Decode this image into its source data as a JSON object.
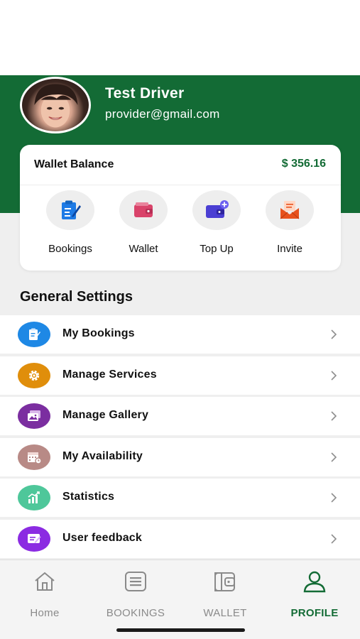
{
  "profile": {
    "name": "Test Driver",
    "email": "provider@gmail.com"
  },
  "wallet": {
    "label": "Wallet Balance",
    "amount": "$ 356.16",
    "actions": [
      {
        "label": "Bookings",
        "icon": "bookings-clipboard-icon",
        "color": "#1e7be6"
      },
      {
        "label": "Wallet",
        "icon": "wallet-icon",
        "color": "#d9436a"
      },
      {
        "label": "Top Up",
        "icon": "top-up-icon",
        "color": "#4b3fd3"
      },
      {
        "label": "Invite",
        "icon": "invite-envelope-icon",
        "color": "#e8521d"
      }
    ]
  },
  "general_settings": {
    "title": "General Settings",
    "items": [
      {
        "label": "My Bookings",
        "icon": "clipboard-icon",
        "color": "#1e88e5"
      },
      {
        "label": "Manage Services",
        "icon": "gear-icon",
        "color": "#e08e0b"
      },
      {
        "label": "Manage Gallery",
        "icon": "gallery-icon",
        "color": "#7b2ea0"
      },
      {
        "label": "My Availability",
        "icon": "calendar-icon",
        "color": "#b88a86"
      },
      {
        "label": "Statistics",
        "icon": "chart-icon",
        "color": "#4ec79a"
      },
      {
        "label": "User feedback",
        "icon": "feedback-icon",
        "color": "#8b2be2"
      }
    ]
  },
  "bottom_nav": {
    "items": [
      {
        "label": "Home",
        "icon": "home-icon",
        "active": false
      },
      {
        "label": "BOOKINGS",
        "icon": "bookings-list-icon",
        "active": false
      },
      {
        "label": "WALLET",
        "icon": "wallet-icon",
        "active": false
      },
      {
        "label": "PROFILE",
        "icon": "profile-icon",
        "active": true
      }
    ]
  },
  "colors": {
    "brand_green": "#136b35",
    "background": "#efefef"
  }
}
